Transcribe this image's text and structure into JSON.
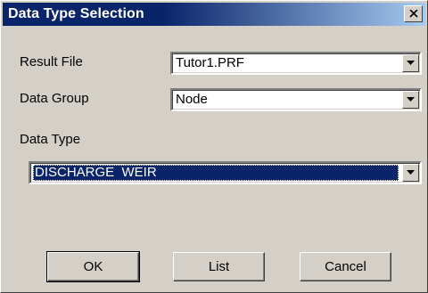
{
  "window": {
    "title": "Data Type Selection",
    "close_icon": "close-x-icon"
  },
  "fields": {
    "result_file": {
      "label": "Result File",
      "value": "Tutor1.PRF"
    },
    "data_group": {
      "label": "Data Group",
      "value": "Node"
    },
    "data_type": {
      "label": "Data Type",
      "value": "DISCHARGE  WEIR"
    }
  },
  "buttons": {
    "ok": "OK",
    "list": "List",
    "cancel": "Cancel"
  },
  "colors": {
    "title_bar": "#0a246a",
    "selection": "#0a246a",
    "face": "#d4d0c8"
  }
}
